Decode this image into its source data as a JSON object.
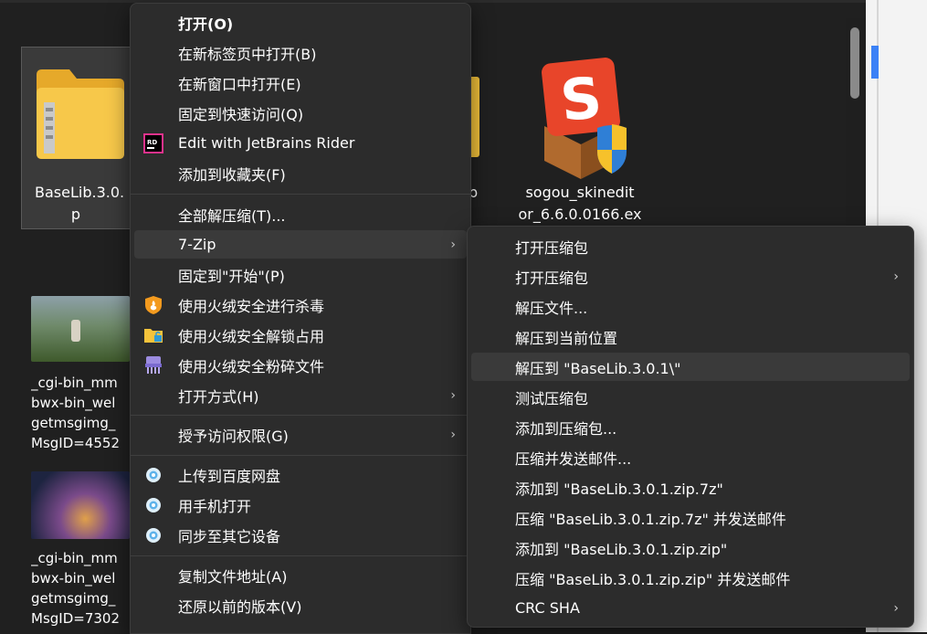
{
  "files": {
    "baselib_name_line1": "BaseLib.3.0.",
    "baselib_name_line2": "p",
    "hidden_zip_suffix": "p",
    "sogou_line1": "sogou_skinedit",
    "sogou_line2": "or_6.6.0.0166.ex",
    "img1_lines": [
      "_cgi-bin_mm",
      "bwx-bin_wel",
      "getmsgimg_",
      "MsgID=4552"
    ],
    "img2_lines": [
      "_cgi-bin_mm",
      "bwx-bin_wel",
      "getmsgimg_",
      "MsgID=7302"
    ]
  },
  "menu": {
    "items": [
      {
        "label": "打开(O)",
        "bold": true
      },
      {
        "label": "在新标签页中打开(B)"
      },
      {
        "label": "在新窗口中打开(E)"
      },
      {
        "label": "固定到快速访问(Q)"
      },
      {
        "label": "Edit with JetBrains Rider",
        "icon": "rider-icon"
      },
      {
        "label": "添加到收藏夹(F)"
      },
      {
        "label": "全部解压缩(T)..."
      },
      {
        "label": "7-Zip",
        "submenu": true
      },
      {
        "label": "固定到\"开始\"(P)"
      },
      {
        "label": "使用火绒安全进行杀毒",
        "icon": "huorong-shield-icon"
      },
      {
        "label": "使用火绒安全解锁占用",
        "icon": "unlock-folder-icon"
      },
      {
        "label": "使用火绒安全粉碎文件",
        "icon": "shredder-icon"
      },
      {
        "label": "打开方式(H)",
        "submenu": true
      },
      {
        "label": "授予访问权限(G)",
        "submenu": true
      },
      {
        "label": "上传到百度网盘",
        "icon": "cloud-icon"
      },
      {
        "label": "用手机打开",
        "icon": "cloud-icon"
      },
      {
        "label": "同步至其它设备",
        "icon": "cloud-icon"
      },
      {
        "label": "复制文件地址(A)"
      },
      {
        "label": "还原以前的版本(V)"
      }
    ]
  },
  "submenu": {
    "items": [
      {
        "label": "打开压缩包"
      },
      {
        "label": "打开压缩包",
        "submenu": true
      },
      {
        "label": "解压文件..."
      },
      {
        "label": "解压到当前位置"
      },
      {
        "label": "解压到 \"BaseLib.3.0.1\\\"",
        "highlighted": true
      },
      {
        "label": "测试压缩包"
      },
      {
        "label": "添加到压缩包..."
      },
      {
        "label": "压缩并发送邮件..."
      },
      {
        "label": "添加到 \"BaseLib.3.0.1.zip.7z\""
      },
      {
        "label": "压缩 \"BaseLib.3.0.1.zip.7z\" 并发送邮件"
      },
      {
        "label": "添加到 \"BaseLib.3.0.1.zip.zip\""
      },
      {
        "label": "压缩 \"BaseLib.3.0.1.zip.zip\" 并发送邮件"
      },
      {
        "label": "CRC SHA",
        "submenu": true
      }
    ]
  },
  "colors": {
    "menu_bg": "#2c2c2c",
    "desktop_bg": "#202020",
    "highlight": "#3a3a3a",
    "folder": "#f5c33b"
  }
}
